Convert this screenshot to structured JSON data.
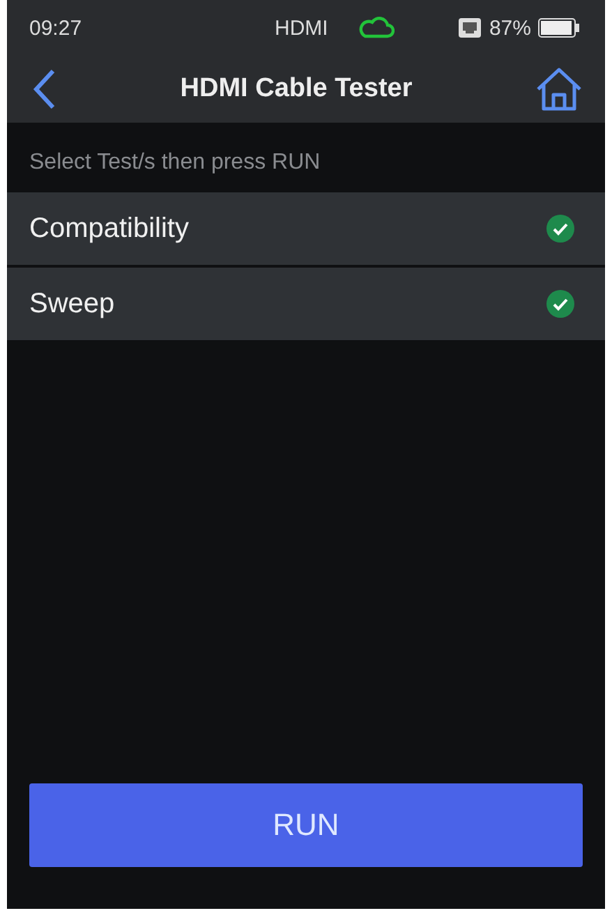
{
  "status_bar": {
    "time": "09:27",
    "connection": "HDMI",
    "battery": "87%"
  },
  "nav": {
    "title": "HDMI Cable Tester"
  },
  "hint": "Select Test/s then press RUN",
  "tests": [
    {
      "label": "Compatibility",
      "checked": true
    },
    {
      "label": "Sweep",
      "checked": true
    }
  ],
  "run_button": "RUN"
}
